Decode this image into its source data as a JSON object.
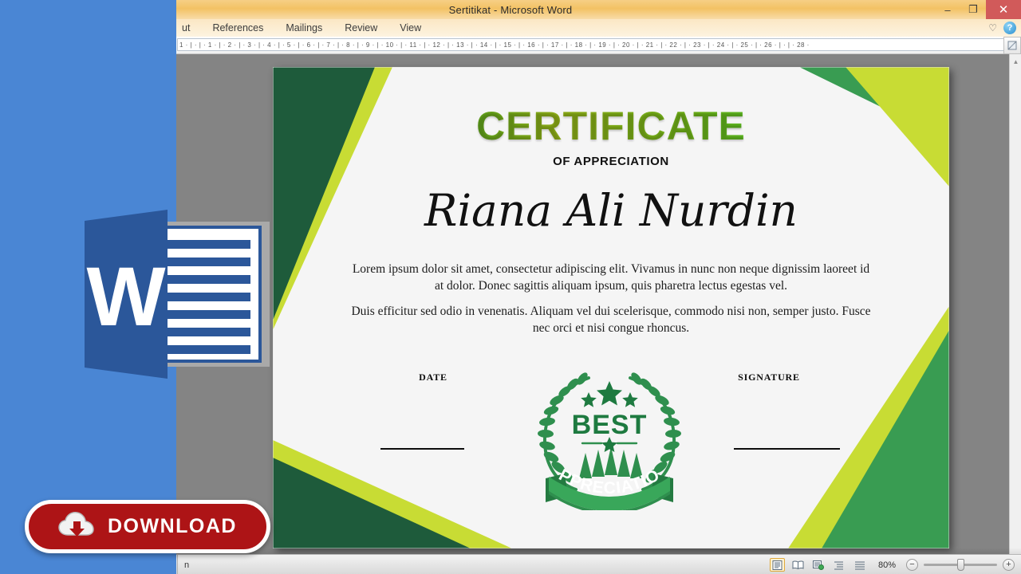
{
  "window": {
    "title": "Sertitikat  -  Microsoft Word",
    "controls": {
      "minimize": "–",
      "restore": "❐",
      "close": "✕"
    }
  },
  "ribbon": {
    "tabs": [
      {
        "label": "ut"
      },
      {
        "label": "References"
      },
      {
        "label": "Mailings"
      },
      {
        "label": "Review"
      },
      {
        "label": "View"
      }
    ],
    "collapse_icon": "♡",
    "help_icon": "?"
  },
  "ruler": {
    "marks": "1  ·  |  ·  |  ·  1  ·  |  ·  2  ·  |  ·  3  ·  |  ·  4  ·  |  ·  5  ·  |  ·  6  ·  |  ·  7  ·  |  ·  8  ·  |  ·  9  ·  |  · 10 ·  |  · 11 ·  |  · 12 ·  |  · 13 ·  |  · 14 ·  |  · 15 ·  |  · 16 ·  |  · 17 ·  |  · 18 ·  |  · 19 ·  |  · 20 ·  |  · 21 ·  |  · 22 ·  |  · 23 ·  |  · 24 ·  |  · 25 ·  |  · 26 ·  |  ·     |  · 28 ·"
  },
  "certificate": {
    "title": "CERTIFICATE",
    "subtitle": "OF APPRECIATION",
    "recipient_name": "Riana Ali Nurdin",
    "paragraph_1": "Lorem ipsum dolor sit amet, consectetur adipiscing elit. Vivamus in nunc non neque dignissim laoreet id at dolor. Donec sagittis aliquam ipsum, quis pharetra lectus egestas vel.",
    "paragraph_2": "Duis efficitur sed odio in venenatis. Aliquam vel dui scelerisque, commodo nisi non, semper justo. Fusce nec orci et nisi congue rhoncus.",
    "date_label": "DATE",
    "signature_label": "SIGNATURE",
    "seal": {
      "center_text": "BEST",
      "ribbon_text": "APPRECIATION"
    },
    "colors": {
      "dark_green": "#1e5b3b",
      "mid_green": "#399c52",
      "lime": "#c8dc34",
      "page_bg": "#f5f5f5",
      "seal_green": "#2f8f4e"
    }
  },
  "overlay": {
    "download_label": "DOWNLOAD",
    "download_color": "#ad1416",
    "panel_color": "#4a86d4",
    "word_logo_color": "#2b579a"
  },
  "status_bar": {
    "language": "n",
    "zoom_level": "80%",
    "zoom_out": "−",
    "zoom_in": "+",
    "views": [
      {
        "name": "print-layout",
        "active": true
      },
      {
        "name": "full-screen-reading",
        "active": false
      },
      {
        "name": "web-layout",
        "active": false
      },
      {
        "name": "outline",
        "active": false
      },
      {
        "name": "draft",
        "active": false
      }
    ]
  }
}
